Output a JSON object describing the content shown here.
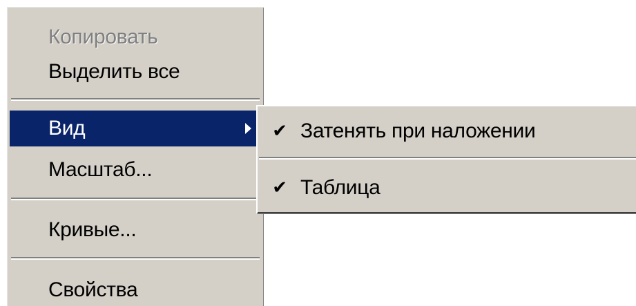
{
  "context_menu": {
    "items": [
      {
        "label": "Копировать",
        "disabled": true
      },
      {
        "label": "Выделить все"
      },
      {
        "label": "Вид",
        "selected": true,
        "has_submenu": true
      },
      {
        "label": "Масштаб..."
      },
      {
        "label": "Кривые..."
      },
      {
        "label": "Свойства"
      }
    ]
  },
  "submenu": {
    "items": [
      {
        "label": "Затенять при наложении",
        "checked": true,
        "check_glyph": "✔"
      },
      {
        "label": "Таблица",
        "checked": true,
        "check_glyph": "✔"
      }
    ]
  },
  "colors": {
    "menu_bg": "#d4d0c8",
    "highlight": "#0a246a",
    "disabled_text": "#808080"
  }
}
